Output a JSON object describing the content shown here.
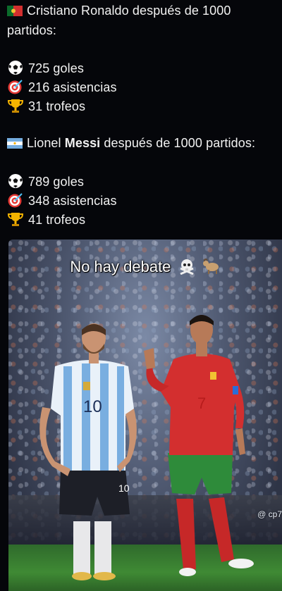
{
  "post": {
    "ronaldo": {
      "header_line1": "Cristiano Ronaldo después de 1000",
      "header_line2": "partidos:",
      "goals": "725 goles",
      "assists": "216 asistencias",
      "trophies": "31 trofeos"
    },
    "messi": {
      "header_prefix": "Lionel ",
      "header_bold": "Messi",
      "header_suffix": " después de 1000 partidos:",
      "goals": "789 goles",
      "assists": "348 asistencias",
      "trophies": "41 trofeos"
    }
  },
  "image": {
    "caption": "No hay debate",
    "watermark": "@ cp7",
    "jersey_number_left": "10",
    "jersey_number_right": "7",
    "shorts_number_left": "10"
  },
  "icons": {
    "portugal_flag": "portugal-flag-icon",
    "argentina_flag": "argentina-flag-icon",
    "ball": "soccer-ball-icon",
    "target": "target-icon",
    "trophy": "trophy-icon",
    "skull": "skull-crossbones-icon",
    "goat": "goat-icon"
  },
  "colors": {
    "background": "#05060a",
    "text": "#f2f2f2",
    "portugal_red": "#d32f2f",
    "argentina_blue": "#74acdf",
    "grass": "#3f8a34"
  }
}
